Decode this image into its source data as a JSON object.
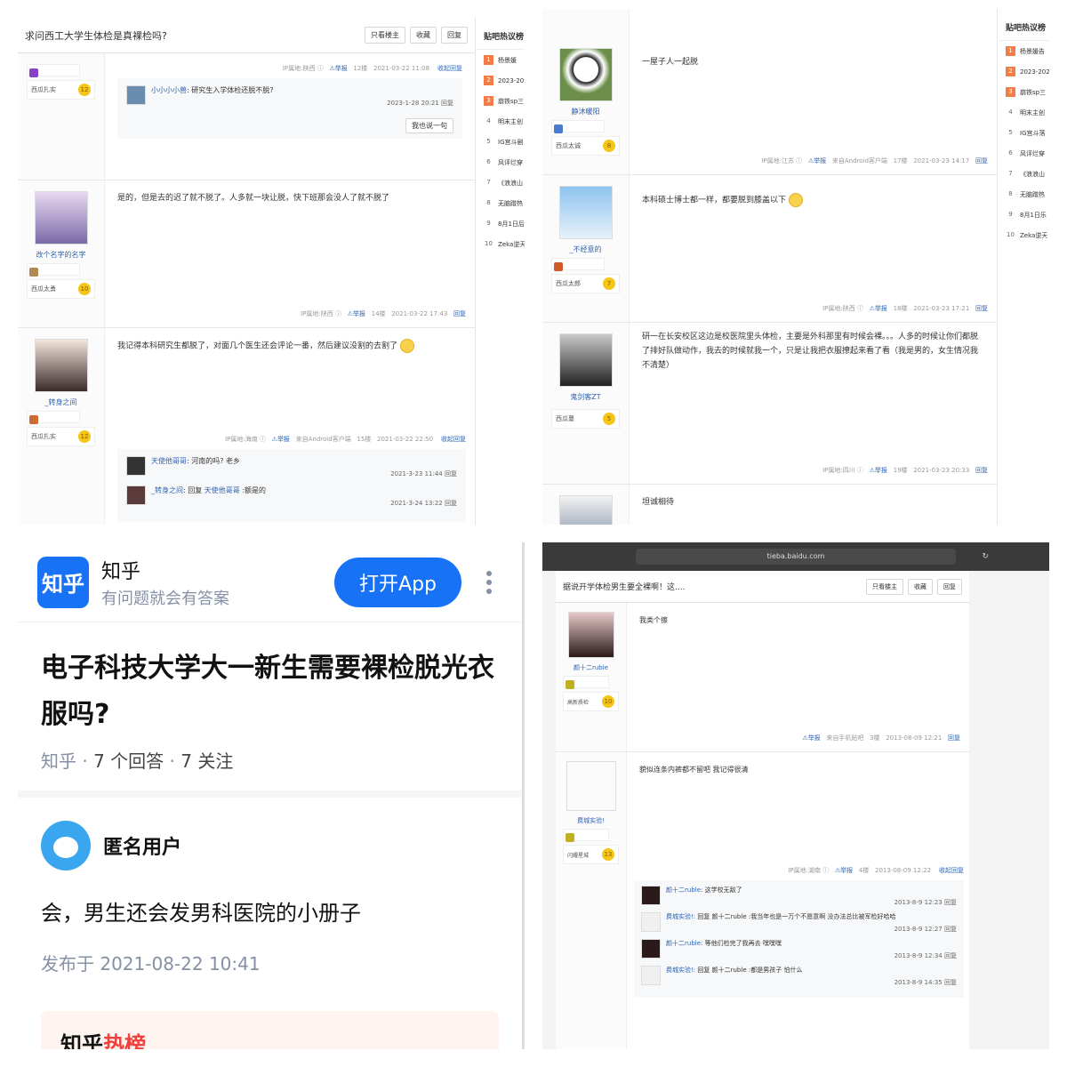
{
  "q1": {
    "title": "求问西工大学生体检是真裸检吗?",
    "buttons": [
      "只看楼主",
      "收藏",
      "回复"
    ],
    "hot_title": "贴吧热议榜",
    "hot_items": [
      {
        "rank": "1",
        "text": "杨景媛"
      },
      {
        "rank": "2",
        "text": "2023-20"
      },
      {
        "rank": "3",
        "text": "崩铁sp三"
      },
      {
        "rank": "4",
        "text": "明末主创"
      },
      {
        "rank": "5",
        "text": "IG宫斗剧"
      },
      {
        "rank": "6",
        "text": "风评烂穿"
      },
      {
        "rank": "7",
        "text": "《浪浪山"
      },
      {
        "rank": "8",
        "text": "无脑蹭热"
      },
      {
        "rank": "9",
        "text": "8月1日后"
      },
      {
        "rank": "10",
        "text": "Zeka逆天"
      }
    ],
    "post12": {
      "level_name": "西瓜扎实",
      "level": "12",
      "meta_ip": "IP属地:陕西",
      "report": "举报",
      "floor": "12楼",
      "time": "2021-03-22 11:08",
      "fold": "收起回复",
      "sub_name": "小小小小兽",
      "sub_text": ": 研究生入学体检还脱不脱?",
      "sub_time": "2023-1-28 20:21",
      "reply": "回复",
      "say": "我也说一句"
    },
    "post14": {
      "username": "改个名字的名字",
      "level_name": "西瓜太勇",
      "level": "10",
      "content": "是的，但是去的迟了就不脱了。人多就一块让脱，快下班那会没人了就不脱了",
      "meta_ip": "IP属地:陕西",
      "report": "举报",
      "floor": "14楼",
      "time": "2021-03-22 17:43",
      "reply": "回复"
    },
    "post15": {
      "username": "_转身之间",
      "level_name": "西瓜扎实",
      "level": "12",
      "content": "我记得本科研究生都脱了，对面几个医生还会评论一番，然后建议没割的去割了",
      "meta_ip": "IP属地:海南",
      "report": "举报",
      "client": "来自Android客户端",
      "floor": "15楼",
      "time": "2021-03-22 22:50",
      "fold": "收起回复",
      "sub1_name": "天使他哥哥",
      "sub1_text": ": 河南的吗? 老乡",
      "sub1_time": "2021-3-23 11:44",
      "reply": "回复",
      "sub2_name": "_转身之间",
      "sub2_mid": ": 回复",
      "sub2_target": "天使他哥哥",
      "sub2_text": " :额是的",
      "sub2_time": "2021-3-24 13:22"
    }
  },
  "q2": {
    "hot_title": "贴吧热议榜",
    "hot_items": [
      {
        "rank": "1",
        "text": "杨景媛告"
      },
      {
        "rank": "2",
        "text": "2023-202"
      },
      {
        "rank": "3",
        "text": "崩铁sp三"
      },
      {
        "rank": "4",
        "text": "明末主创"
      },
      {
        "rank": "5",
        "text": "IG宫斗落"
      },
      {
        "rank": "6",
        "text": "风评烂穿"
      },
      {
        "rank": "7",
        "text": "《浪浪山"
      },
      {
        "rank": "8",
        "text": "无脑蹭热"
      },
      {
        "rank": "9",
        "text": "8月1日乐"
      },
      {
        "rank": "10",
        "text": "Zeka逆天"
      }
    ],
    "post17": {
      "username": "静沐暖阳",
      "level_name": "西瓜太诚",
      "level": "8",
      "content": "一屋子人一起脱",
      "meta_ip": "IP属地:江苏",
      "report": "举报",
      "client": "来自Android客户端",
      "floor": "17楼",
      "time": "2021-03-23 14:17",
      "reply": "回复"
    },
    "post18": {
      "username": "_不经意的",
      "level_name": "西瓜太郎",
      "level": "7",
      "content": "本科硕士博士都一样，都要脱到膝盖以下",
      "meta_ip": "IP属地:陕西",
      "report": "举报",
      "floor": "18楼",
      "time": "2021-03-23 17:21",
      "reply": "回复"
    },
    "post19": {
      "username": "鬼剑客ZT",
      "level_name": "西瓜蔓",
      "level": "5",
      "content": "研一在长安校区这边是校医院里头体检，主要是外科那里有时候会裸。。。人多的时候让你们都脱了排好队做动作，我去的时候就我一个，只是让我把衣服撩起来看了看（我是男的，女生情况我不清楚）",
      "meta_ip": "IP属地:四川",
      "report": "举报",
      "floor": "19楼",
      "time": "2021-03-23 20:33",
      "reply": "回复"
    },
    "post20": {
      "content": "坦诚相待"
    }
  },
  "q3": {
    "app_name": "知乎",
    "slogan": "有问题就会有答案",
    "open_app": "打开App",
    "question": "电子科技大学大一新生需要裸检脱光衣服吗?",
    "meta_source": "知乎",
    "meta_answers": "7 个回答",
    "meta_follows": "7 关注",
    "answer_user": "匿名用户",
    "answer_text": "会，男生还会发男科医院的小册子",
    "published": "发布于 2021-08-22 10:41",
    "hot_a": "知乎",
    "hot_b": "热榜"
  },
  "q4": {
    "url": "tieba.baidu.com",
    "title": "据说开学体检男生要全裸啊！这....",
    "buttons": [
      "只看楼主",
      "收藏",
      "回复"
    ],
    "post3": {
      "username": "颜十二ruble",
      "level_name": "高新质检",
      "level": "10",
      "content": "我类个擦",
      "report": "举报",
      "client": "来自手机贴吧",
      "floor": "3楼",
      "time": "2013-08-09 12:21",
      "reply": "回复"
    },
    "post4": {
      "username": "费城实验!",
      "level_name": "闪耀星城",
      "level": "13",
      "content": "貌似连条内裤都不留吧 我记得很清",
      "meta_ip": "IP属地:湖南",
      "report": "举报",
      "floor": "4楼",
      "time": "2013-08-09 12:22",
      "fold": "收起回复",
      "subs": [
        {
          "name": "颜十二ruble:",
          "text": " 这学校无敌了",
          "time": "2013-8-9 12:23"
        },
        {
          "name": "费城实验!:",
          "text": " 回复 颜十二ruble :我当年也是一万个不愿意啊 没办法总比被军检好哈哈",
          "time": "2013-8-9 12:27"
        },
        {
          "name": "颜十二ruble:",
          "text": " 等他们检完了我再去 嘿嘿嘿",
          "time": "2013-8-9 12:34"
        },
        {
          "name": "费城实验!:",
          "text": " 回复 颜十二ruble :都是男孩子 怕什么",
          "time": "2013-8-9 14:35"
        }
      ],
      "reply": "回复"
    }
  }
}
